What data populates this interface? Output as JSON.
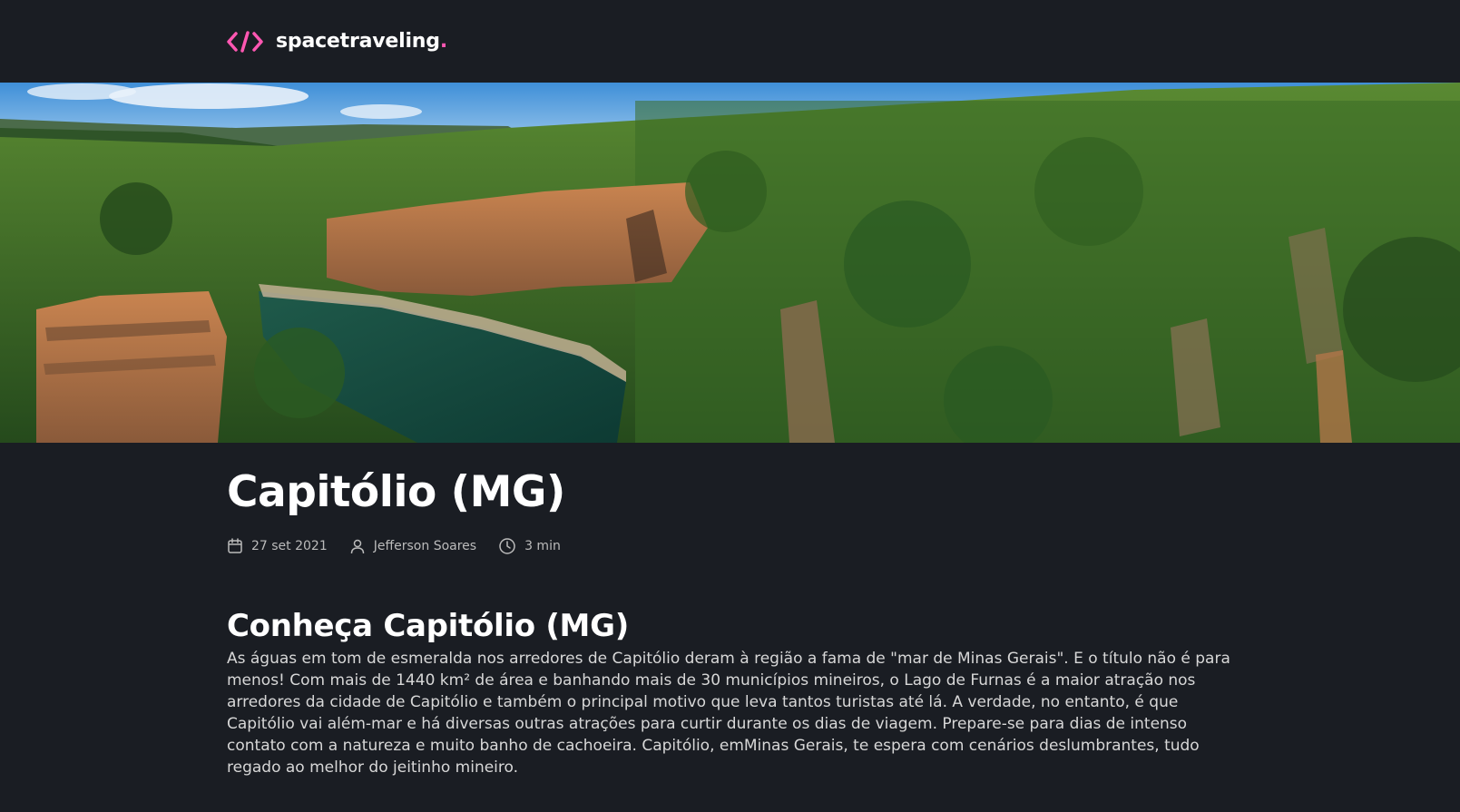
{
  "header": {
    "logo_text": "spacetraveling",
    "logo_dot": ".",
    "logo_icon": "code-brackets-icon"
  },
  "banner": {
    "icon": "landscape-photo"
  },
  "post": {
    "title": "Capitólio (MG)",
    "date": "27 set 2021",
    "author": "Jefferson Soares",
    "reading_time": "3 min",
    "section_heading": "Conheça Capitólio (MG)",
    "section_body": "As águas em tom de esmeralda nos arredores de Capitólio deram à região a fama de \"mar de Minas Gerais\". E o título não é para menos! Com mais de 1440 km² de área e banhando mais de 30 municípios mineiros, o Lago de Furnas é a maior atração nos arredores da cidade de Capitólio e também o principal motivo que leva tantos turistas até lá. A verdade, no entanto, é que Capitólio vai além-mar e há diversas outras atrações para curtir durante os dias de viagem. Prepare-se para dias de intenso contato com a natureza e muito banho de cachoeira. Capitólio, emMinas Gerais, te espera com cenários deslumbrantes, tudo regado ao melhor do jeitinho mineiro."
  },
  "colors": {
    "background": "#1a1d23",
    "accent": "#ff57b2",
    "text": "#ffffff",
    "muted": "#bbbbbb"
  }
}
